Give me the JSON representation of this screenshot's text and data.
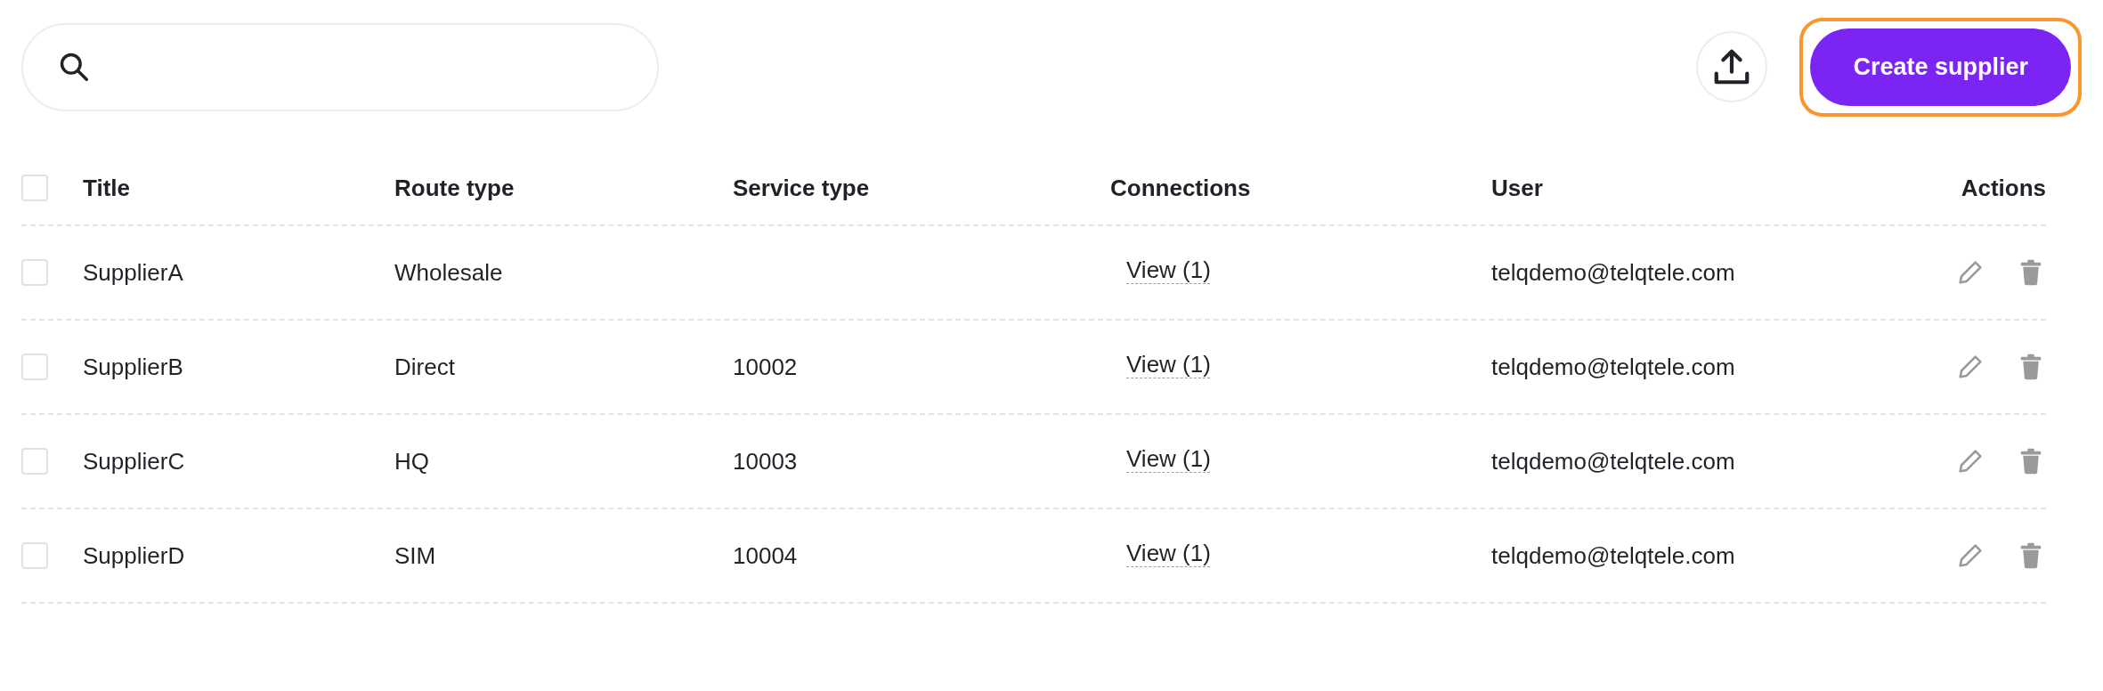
{
  "toolbar": {
    "create_button": "Create supplier",
    "create_focused": true
  },
  "table": {
    "select_all": {
      "checked": false
    },
    "columns": [
      "Title",
      "Route type",
      "Service type",
      "Connections",
      "User",
      "Actions"
    ],
    "rows": [
      {
        "checked": false,
        "title": "SupplierA",
        "route_type": "Wholesale",
        "connections": "View (1)",
        "user": "telqdemo@telqtele.com"
      },
      {
        "checked": false,
        "title": "SupplierB",
        "route_type": "Direct",
        "service_type": "10002",
        "connections": "View (1)",
        "user": "telqdemo@telqtele.com"
      },
      {
        "checked": false,
        "title": "SupplierC",
        "route_type": "HQ",
        "service_type": "10003",
        "connections": "View (1)",
        "user": "telqdemo@telqtele.com"
      },
      {
        "checked": false,
        "title": "SupplierD",
        "route_type": "SIM",
        "service_type": "10004",
        "connections": "View (1)",
        "user": "telqdemo@telqtele.com"
      }
    ]
  }
}
